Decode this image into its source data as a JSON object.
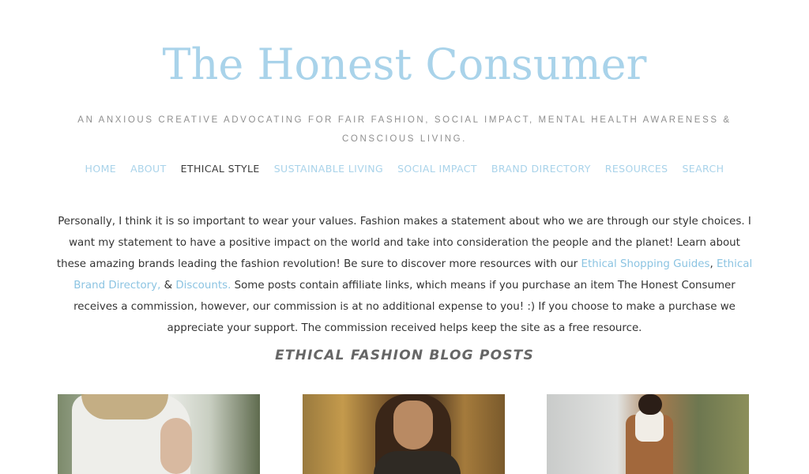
{
  "site": {
    "title": "The Honest Consumer",
    "tagline": "AN ANXIOUS CREATIVE ADVOCATING FOR FAIR FASHION, SOCIAL IMPACT, MENTAL HEALTH AWARENESS & CONSCIOUS LIVING."
  },
  "nav": {
    "items": [
      {
        "label": "HOME"
      },
      {
        "label": "ABOUT"
      },
      {
        "label": "ETHICAL STYLE"
      },
      {
        "label": "SUSTAINABLE LIVING"
      },
      {
        "label": "SOCIAL IMPACT"
      },
      {
        "label": "BRAND DIRECTORY"
      },
      {
        "label": "RESOURCES"
      },
      {
        "label": "SEARCH"
      }
    ]
  },
  "intro": {
    "part1": "Personally, I think it is so important to wear your values. Fashion makes a statement about who we are through our style choices. I want my statement to have a positive impact on the world and take into consideration the people and the planet! Learn about these amazing brands leading the fashion revolution! Be sure to discover more resources with our ",
    "link1": "Ethical Shopping Guides",
    "sep1": ", ",
    "link2": "Ethical Brand Directory,",
    "sep2": " & ",
    "link3": "Discounts.",
    "part2": " Some posts contain affiliate links, which means if you purchase an item The Honest Consumer receives a commission, however, our commission is at no additional expense to you! :) If you choose to make a purchase we appreciate your support. The commission received helps keep the site as a free resource."
  },
  "section": {
    "heading": "ETHICAL FASHION BLOG POSTS"
  },
  "colors": {
    "accent": "#a9d3ea",
    "link": "#8cc4e2",
    "text": "#333333",
    "active_nav": "#3b3b3b"
  }
}
